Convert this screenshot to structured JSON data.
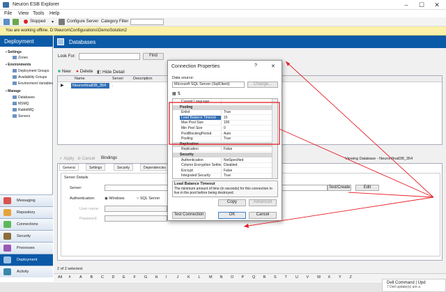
{
  "app": {
    "title": "Neuron ESB Explorer",
    "window_controls": [
      "–",
      "☐",
      "✕"
    ]
  },
  "menu": [
    "File",
    "View",
    "Tools",
    "Help"
  ],
  "toolbar": {
    "status": "Stopped",
    "configure_server": "Configure Server",
    "category_filter": "Category Filter"
  },
  "offline_message": "You are working offline. D:\\Neuron\\Configurations\\DemoSolution2",
  "sidebar": {
    "header": "Deployment",
    "tree": {
      "settings": "Settings",
      "zones": "Zones",
      "environments": "Environments",
      "deployment_groups": "Deployment Groups",
      "availability_groups": "Availability Groups",
      "environment_variables": "Environment Variables",
      "manage": "Manage",
      "databases": "Databases",
      "msmq": "MSMQ",
      "rabbitmq": "RabbitMQ",
      "servers": "Servers"
    },
    "nav": [
      "Messaging",
      "Repository",
      "Connections",
      "Security",
      "Processes",
      "Deployment",
      "Activity"
    ]
  },
  "main": {
    "header": "Databases",
    "look_for": "Look For:",
    "find": "Find",
    "actions": {
      "new": "New",
      "delete": "Delete",
      "hide_detail": "Hide Detail"
    },
    "columns": {
      "name": "Name",
      "server": "Server",
      "description": "Description"
    },
    "row": {
      "name": "NeuronfinalDB_354",
      "server": "."
    },
    "detail_actions": {
      "apply": "Apply",
      "cancel": "Cancel",
      "bindings": "Bindings"
    },
    "viewing": "Viewing Database - NeuronfinalDB_354",
    "tabs": [
      "General",
      "Settings",
      "Security",
      "Dependencies"
    ],
    "server_details": "Server Details",
    "server_label": "Server:",
    "server_value": ".",
    "auth_label": "Authentication:",
    "auth_windows": "Windows",
    "auth_sql": "SQL Server",
    "user_label": "User name:",
    "password_label": "Password:",
    "test_create": "Test/Create",
    "edit": "Edit",
    "status": "2 of 2 selected.",
    "alphabet": [
      "All",
      "#",
      "A",
      "B",
      "C",
      "D",
      "E",
      "F",
      "G",
      "H",
      "I",
      "J",
      "K",
      "L",
      "M",
      "N",
      "O",
      "P",
      "Q",
      "R",
      "S",
      "T",
      "U",
      "V",
      "W",
      "X",
      "Y",
      "Z"
    ]
  },
  "dialog": {
    "title": "Connection Properties",
    "help": "?",
    "close": "✕",
    "data_source_label": "Data source:",
    "data_source_value": "Microsoft SQL Server (SqlClient)",
    "change": "Change...",
    "properties": [
      {
        "k": "Current Language",
        "v": ""
      },
      {
        "cat": "Pooling"
      },
      {
        "k": "Enlist",
        "v": "True"
      },
      {
        "k": "Load Balance Timeout",
        "v": "15",
        "selected": true
      },
      {
        "k": "Max Pool Size",
        "v": "100"
      },
      {
        "k": "Min Pool Size",
        "v": "0"
      },
      {
        "k": "PoolBlockingPeriod",
        "v": "Auto"
      },
      {
        "k": "Pooling",
        "v": "True"
      },
      {
        "cat": "Replication"
      },
      {
        "k": "Replication",
        "v": "False"
      },
      {
        "cat": "Security"
      },
      {
        "k": "Authentication",
        "v": "NotSpecified"
      },
      {
        "k": "Column Encryption Setting",
        "v": "Disabled"
      },
      {
        "k": "Encrypt",
        "v": "False"
      },
      {
        "k": "Integrated Security",
        "v": "True"
      }
    ],
    "desc_title": "Load Balance Timeout",
    "desc_text": "The minimum amount of time (in seconds) for this connection to live in the pool before being destroyed.",
    "copy": "Copy",
    "advanced": "Advanced",
    "test_connection": "Test Connection",
    "ok": "OK",
    "cancel": "Cancel"
  },
  "toast": {
    "title": "Dell Command | Upd",
    "sub": "7 Dell update(s) are a"
  },
  "colors": {
    "accent": "#0b5aa7",
    "highlight": "#e41c24",
    "selected_row": "#2f6db5"
  }
}
